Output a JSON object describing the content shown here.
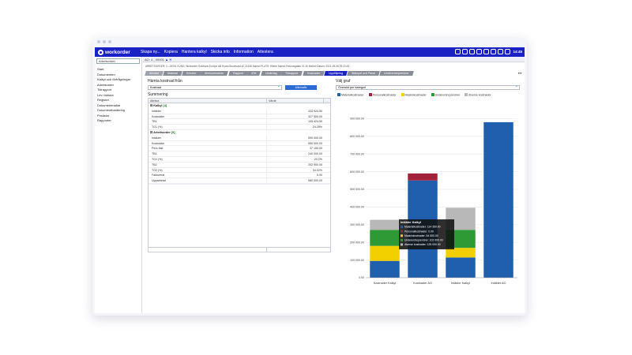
{
  "app": {
    "logo": "workorder",
    "menu": [
      "Skapa ny...",
      "Kopiera",
      "Hantera kalkyl",
      "Skicka info",
      "Information",
      "Attestera"
    ],
    "clock": "14:45"
  },
  "sidebar": {
    "search_value": "Arbetsorder",
    "items": [
      "Start",
      "Dokumenten",
      "Kalkyl och förfrågningar",
      "Arbetsorder",
      "Tidrapport",
      "Lev. faktura",
      "Register",
      "Dokumentmallar",
      "Dokumenthantering",
      "Prislistor",
      "Rapporter"
    ]
  },
  "tabstrip": {
    "tab_label": "AO: 4 - 00001",
    "close": "▲ ✕"
  },
  "infoline": "ARBETSORDER: 4 - 00001 KUND: Workorder Solutions Europe AB Hydro Boulevard 42 21526 Malmö PLATS: Hillebr Malmö Rekonsgatan 21 30 Malmö Datum: 2021-09-06 09:22:43",
  "subtabs": [
    "Allmänt",
    "Material",
    "Enheter",
    "Alerkommande",
    "Rapport",
    "ATA",
    "Underlag",
    "Tidrapport",
    "Kostnader",
    "Uppföljning",
    "Stämpel och Panel",
    "Underentreprenörer"
  ],
  "active_subtab": "Uppföljning",
  "left": {
    "fetch_label": "Hämta kostnad från",
    "fetch_value": "Kostnad",
    "alt_button": "Alternativ",
    "summary_label": "Summering",
    "col_attr": "Attribut",
    "col_value": "Värde",
    "col_more": "···",
    "groups": [
      {
        "name": "Kalkyl",
        "count": "[4]",
        "rows": [
          {
            "label": "Intäkter",
            "value": "433 924.50"
          },
          {
            "label": "Kostnader",
            "value": "327 500.00"
          },
          {
            "label": "TB1",
            "value": "105 424.50"
          },
          {
            "label": "TG1 (%)",
            "value": "24.25%"
          }
        ]
      },
      {
        "name": "Arbetsorder",
        "count": "[9]",
        "rows": [
          {
            "label": "Intäkter",
            "value": "590 000.00"
          },
          {
            "label": "Kostnader",
            "value": "550 000.00"
          },
          {
            "label": "Pers-fast",
            "value": "37 150.00"
          },
          {
            "label": "TB1",
            "value": "240 000.00"
          },
          {
            "label": "TG1 (%)",
            "value": "20.2%"
          },
          {
            "label": "TB2",
            "value": "202 900.00"
          },
          {
            "label": "TG2 (%)",
            "value": "34.02%"
          },
          {
            "label": "Fakturerat",
            "value": "0.00"
          },
          {
            "label": "Upparbetat",
            "value": "580 000.00"
          }
        ]
      }
    ]
  },
  "right": {
    "chart_label": "Välj graf",
    "chart_select": "Översikt per kategori"
  },
  "colors": {
    "brand": "#1a22c4",
    "material": "#1f5fae",
    "personal": "#a3213a",
    "maskin": "#f2d000",
    "underentreprenor": "#2e9a36",
    "diverse": "#b8b8b8"
  },
  "chart_data": {
    "type": "bar",
    "stacked": true,
    "categories": [
      "Kostnader Kalkyl",
      "Kostnader AO",
      "Intäkter Kalkyl",
      "Intäkter AO"
    ],
    "series": [
      {
        "name": "Materialkostnader",
        "values": [
          95000,
          550000,
          114350,
          880000
        ]
      },
      {
        "name": "Personalkostnader",
        "values": [
          0,
          40000,
          0,
          0
        ]
      },
      {
        "name": "Maskinkostnader",
        "values": [
          85000,
          0,
          54500,
          0
        ]
      },
      {
        "name": "Underentreprenörer",
        "values": [
          90000,
          0,
          102000,
          0
        ]
      },
      {
        "name": "diverse kostnader",
        "values": [
          57500,
          0,
          125000,
          0
        ]
      }
    ],
    "ylim": [
      0,
      1000000
    ],
    "yticks": [
      "0.00",
      "100 000.00",
      "200 000.00",
      "300 000.00",
      "400 000.00",
      "500 000.00",
      "600 000.00",
      "700 000.00",
      "800 000.00",
      "900 000.00"
    ],
    "grid": true,
    "legend": "top",
    "tooltip": {
      "title": "Intäkter Kalkyl",
      "lines": [
        "Materialkostnader: 114 350.00",
        "Personalkostnader: 0.00",
        "Maskinkostnader: 54 500.00",
        "Underentreprenörer: 102 000.00",
        "diverse kostnader: 125 000.00"
      ]
    }
  }
}
